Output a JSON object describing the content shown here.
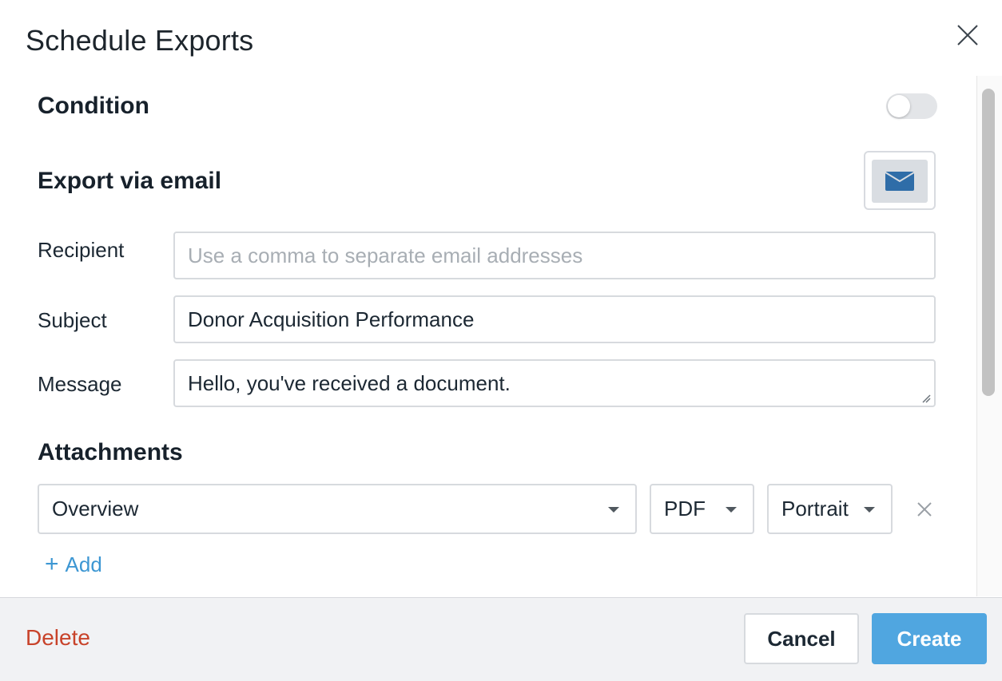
{
  "dialog": {
    "title": "Schedule Exports"
  },
  "condition": {
    "heading": "Condition",
    "toggle_on": false
  },
  "export_email": {
    "heading": "Export via email",
    "icon": "envelope-icon"
  },
  "form": {
    "recipient_label": "Recipient",
    "recipient_placeholder": "Use a comma to separate email addresses",
    "recipient_value": "",
    "subject_label": "Subject",
    "subject_value": "Donor Acquisition Performance",
    "message_label": "Message",
    "message_value": "Hello, you've received a document."
  },
  "attachments": {
    "heading": "Attachments",
    "items": [
      {
        "dashboard": "Overview",
        "format": "PDF",
        "orientation": "Portrait"
      }
    ],
    "add_label": "Add"
  },
  "footer": {
    "delete_label": "Delete",
    "cancel_label": "Cancel",
    "create_label": "Create"
  },
  "colors": {
    "accent": "#50a6e0",
    "link": "#3d97d3",
    "danger": "#c8432a",
    "envelope": "#2f6da8"
  }
}
